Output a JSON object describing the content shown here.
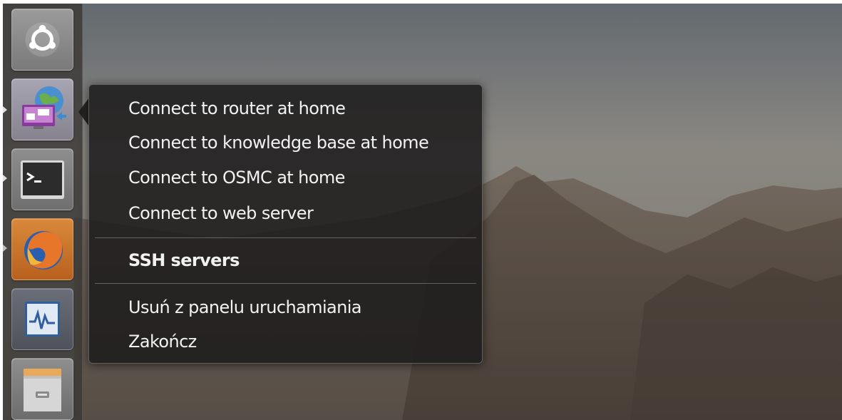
{
  "launcher": {
    "items": [
      {
        "name": "ubuntu-dash",
        "icon": "ubuntu-logo-icon",
        "running": false
      },
      {
        "name": "ssh-servers",
        "icon": "remote-desktop-icon",
        "running": true,
        "active": true
      },
      {
        "name": "terminal",
        "icon": "terminal-icon",
        "running": true
      },
      {
        "name": "firefox",
        "icon": "firefox-icon",
        "running": true
      },
      {
        "name": "system-monitor",
        "icon": "system-monitor-icon",
        "running": false
      },
      {
        "name": "files",
        "icon": "file-cabinet-icon",
        "running": false
      }
    ]
  },
  "quicklist": {
    "actions": [
      "Connect to router at home",
      "Connect to knowledge base at home",
      "Connect to OSMC at home",
      "Connect to web server"
    ],
    "app_title": "SSH servers",
    "footer": [
      "Usuń z panelu uruchamiania",
      "Zakończ"
    ]
  },
  "colors": {
    "launcher_bg": "#3a3836",
    "menu_bg": "#1e1d1c",
    "menu_text": "#f2f2f2"
  }
}
